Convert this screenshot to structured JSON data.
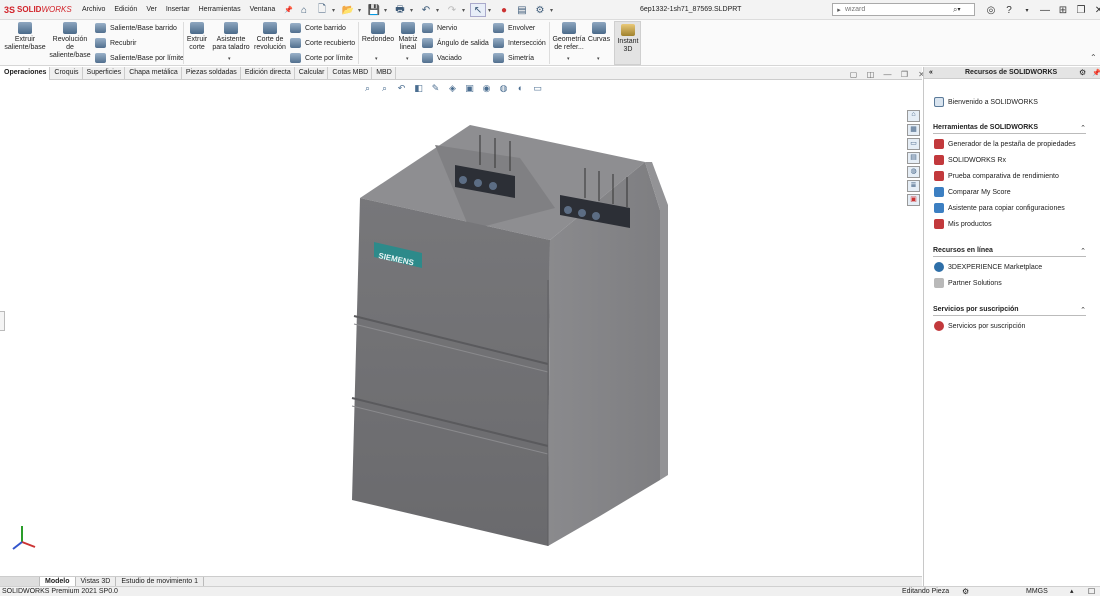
{
  "app": {
    "logo_prefix": "3S",
    "logo_bold": "SOLID",
    "logo_rest": "WORKS",
    "document_title": "6ep1332-1sh71_87569.SLDPRT"
  },
  "menu": [
    "Archivo",
    "Edición",
    "Ver",
    "Insertar",
    "Herramientas",
    "Ventana"
  ],
  "search": {
    "value": "wizard"
  },
  "ribbon": {
    "extrude_boss": "Extruir saliente/base",
    "revolve_boss": "Revolución de saliente/base",
    "swept_boss": "Saliente/Base barrido",
    "loft": "Recubrir",
    "boundary_boss": "Saliente/Base por límite",
    "extrude_cut": "Extruir corte",
    "hole_wizard": "Asistente para taladro",
    "revolve_cut": "Corte de revolución",
    "swept_cut": "Corte barrido",
    "lofted_cut": "Corte recubierto",
    "boundary_cut": "Corte por límite",
    "fillet": "Redondeo",
    "linear_pattern": "Matriz lineal",
    "rib": "Nervio",
    "draft": "Ángulo de salida",
    "shell": "Vaciado",
    "wrap": "Envolver",
    "intersect": "Intersección",
    "mirror": "Simetría",
    "ref_geometry": "Geometría de refer...",
    "curves": "Curvas",
    "instant3d": "Instant 3D"
  },
  "tabs": [
    "Operaciones",
    "Croquis",
    "Superficies",
    "Chapa metálica",
    "Piezas soldadas",
    "Edición directa",
    "Calcular",
    "Cotas MBD",
    "MBD"
  ],
  "model": {
    "brand_label": "SIEMENS"
  },
  "bottom_tabs": [
    "Modelo",
    "Vistas 3D",
    "Estudio de movimiento 1"
  ],
  "status": {
    "left": "SOLIDWORKS Premium 2021 SP0.0",
    "mode": "Editando Pieza",
    "units": "MMGS"
  },
  "panel": {
    "title": "Recursos de SOLIDWORKS",
    "welcome": "Bienvenido a SOLIDWORKS",
    "tools_header": "Herramientas de SOLIDWORKS",
    "tools": [
      "Generador de la pestaña de propiedades",
      "SOLIDWORKS Rx",
      "Prueba comparativa de rendimiento",
      "Comparar My Score",
      "Asistente para copiar configuraciones",
      "Mis productos"
    ],
    "online_header": "Recursos en línea",
    "online": [
      "3DEXPERIENCE Marketplace",
      "Partner Solutions"
    ],
    "subs_header": "Servicios por suscripción",
    "subs": [
      "Servicios por suscripción"
    ]
  },
  "colors": {
    "brand_red": "#d2232a",
    "model_body": "#6e6e70",
    "siemens_label": "#2d8a8a"
  }
}
